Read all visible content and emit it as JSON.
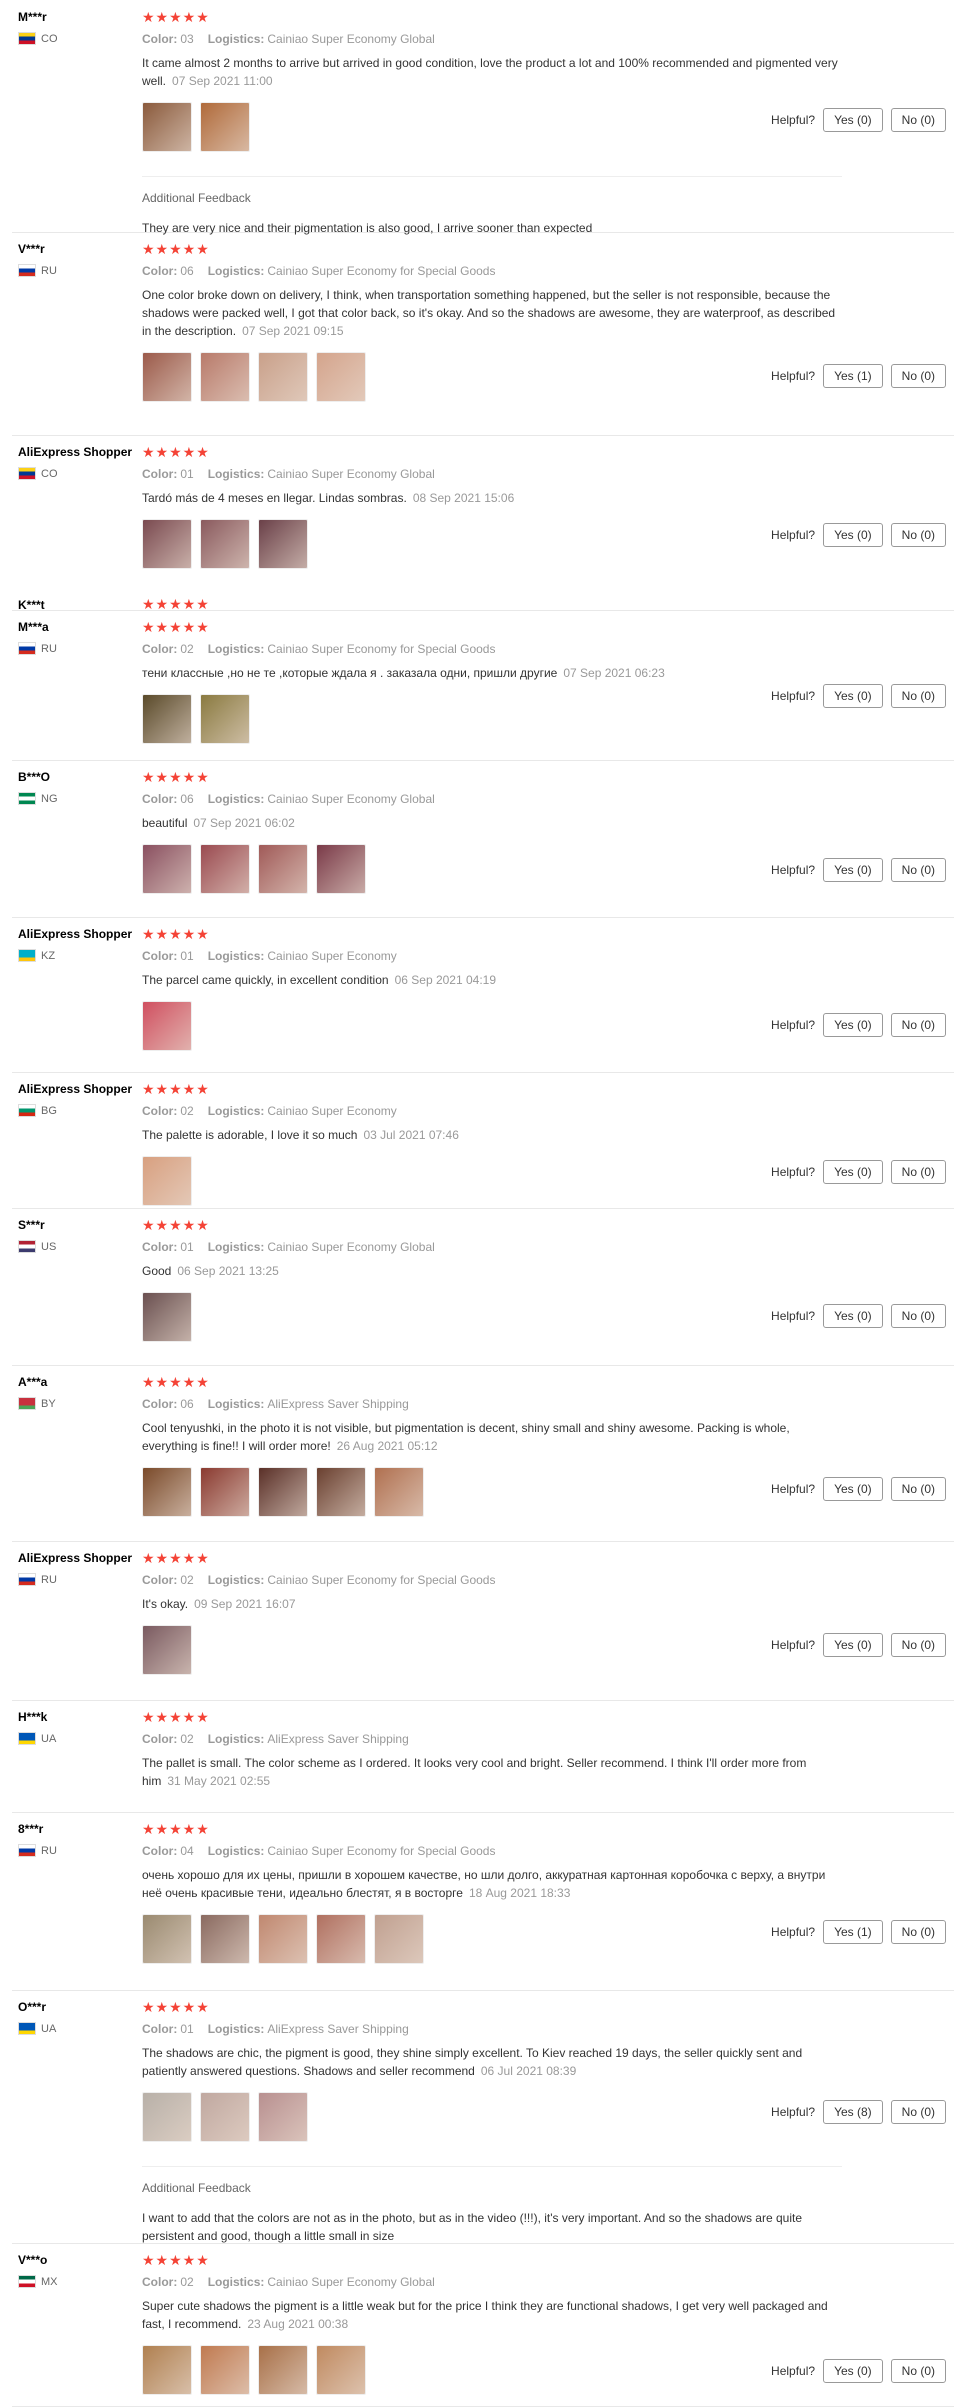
{
  "ui": {
    "color_label": "Color:",
    "logistics_label": "Logistics:",
    "helpful_label": "Helpful?",
    "additional_feedback_label": "Additional Feedback",
    "stars": "★★★★★"
  },
  "reviews": [
    {
      "user": "M***r",
      "country": "CO",
      "flag": [
        "#fcd116",
        "#003893",
        "#ce1126"
      ],
      "color": "03",
      "logistics": "Cainiao Super Economy Global",
      "text": "It came almost 2 months to arrive but arrived in good condition, love the product a lot and 100% recommended and pigmented very well.",
      "date": "07 Sep 2021 11:00",
      "yes": "Yes (0)",
      "no": "No (0)",
      "thumbs": [
        "#8a5a3c",
        "#b06a3a"
      ],
      "additional": "They are very nice and their pigmentation is also good, I arrive sooner than expected"
    },
    {
      "user": "V***r",
      "country": "RU",
      "flag": [
        "#ffffff",
        "#0039a6",
        "#d52b1e"
      ],
      "color": "06",
      "logistics": "Cainiao Super Economy for Special Goods",
      "text": "One color broke down on delivery, I think, when transportation something happened, but the seller is not responsible, because the shadows were packed well, I got that color back, so it's okay. And so the shadows are awesome, they are waterproof, as described in the description.",
      "date": "07 Sep 2021 09:15",
      "yes": "Yes (1)",
      "no": "No (0)",
      "thumbs": [
        "#9b5a4a",
        "#b87a6a",
        "#c9a08a",
        "#d4a48c"
      ]
    },
    {
      "user": "AliExpress Shopper",
      "country": "CO",
      "flag": [
        "#fcd116",
        "#003893",
        "#ce1126"
      ],
      "color": "01",
      "logistics": "Cainiao Super Economy Global",
      "text": "Tardó más de 4 meses en llegar. Lindas sombras.",
      "date": "08 Sep 2021 15:06",
      "yes": "Yes (0)",
      "no": "No (0)",
      "thumbs": [
        "#7a4a50",
        "#8a5a5e",
        "#6a4048"
      ]
    },
    {
      "user": "M***a",
      "country": "RU",
      "flag": [
        "#ffffff",
        "#0039a6",
        "#d52b1e"
      ],
      "color": "02",
      "logistics": "Cainiao Super Economy for Special Goods",
      "text": "тени классные ,но не те ,которые ждала я . заказала одни, пришли другие",
      "date": "07 Sep 2021 06:23",
      "yes": "Yes (0)",
      "no": "No (0)",
      "thumbs": [
        "#5a4a2a",
        "#8a7a40"
      ]
    },
    {
      "user": "B***O",
      "country": "NG",
      "flag": [
        "#008751",
        "#ffffff",
        "#008751"
      ],
      "color": "06",
      "logistics": "Cainiao Super Economy Global",
      "text": "beautiful",
      "date": "07 Sep 2021 06:02",
      "yes": "Yes (0)",
      "no": "No (0)",
      "thumbs": [
        "#8a5060",
        "#9a4a50",
        "#a05a58",
        "#7a3a48"
      ]
    },
    {
      "user": "AliExpress Shopper",
      "country": "KZ",
      "flag": [
        "#00afca",
        "#00afca",
        "#fec50c"
      ],
      "color": "01",
      "logistics": "Cainiao Super Economy",
      "text": "The parcel came quickly, in excellent condition",
      "date": "06 Sep 2021 04:19",
      "yes": "Yes (0)",
      "no": "No (0)",
      "thumbs": [
        "#d05060"
      ]
    },
    {
      "user": "AliExpress Shopper",
      "country": "BG",
      "flag": [
        "#ffffff",
        "#00966e",
        "#d62612"
      ],
      "color": "02",
      "logistics": "Cainiao Super Economy",
      "text": "The palette is adorable, I love it so much",
      "date": "03 Jul 2021 07:46",
      "yes": "Yes (0)",
      "no": "No (0)",
      "thumbs": [
        "#d8a080"
      ]
    },
    {
      "user": "S***r",
      "country": "US",
      "flag": [
        "#b22234",
        "#ffffff",
        "#3c3b6e"
      ],
      "color": "01",
      "logistics": "Cainiao Super Economy Global",
      "text": "Good",
      "date": "06 Sep 2021 13:25",
      "yes": "Yes (0)",
      "no": "No (0)",
      "thumbs": [
        "#6a5050"
      ]
    },
    {
      "user": "A***a",
      "country": "BY",
      "flag": [
        "#c8313e",
        "#c8313e",
        "#4aa657"
      ],
      "color": "06",
      "logistics": "AliExpress Saver Shipping",
      "text": "Cool tenyushki, in the photo it is not visible, but pigmentation is decent, shiny small and shiny awesome. Packing is whole, everything is fine!! I will order more!",
      "date": "26 Aug 2021 05:12",
      "yes": "Yes (0)",
      "no": "No (0)",
      "thumbs": [
        "#7a4a2a",
        "#8a3a30",
        "#5a3028",
        "#6a4030",
        "#b07050"
      ]
    },
    {
      "user": "AliExpress Shopper",
      "country": "RU",
      "flag": [
        "#ffffff",
        "#0039a6",
        "#d52b1e"
      ],
      "color": "02",
      "logistics": "Cainiao Super Economy for Special Goods",
      "text": "It's okay.",
      "date": "09 Sep 2021 16:07",
      "yes": "Yes (0)",
      "no": "No (0)",
      "thumbs": [
        "#7a5a60"
      ]
    },
    {
      "user": "H***k",
      "country": "UA",
      "flag": [
        "#0057b7",
        "#0057b7",
        "#ffd700"
      ],
      "color": "02",
      "logistics": "AliExpress Saver Shipping",
      "text": "The pallet is small. The color scheme as I ordered. It looks very cool and bright. Seller recommend. I think I'll order more from him",
      "date": "31 May 2021 02:55"
    },
    {
      "user": "8***r",
      "country": "RU",
      "flag": [
        "#ffffff",
        "#0039a6",
        "#d52b1e"
      ],
      "color": "04",
      "logistics": "Cainiao Super Economy for Special Goods",
      "text": "очень хорошо для их цены, пришли в хорошем качестве, но шли долго, аккуратная картонная коробочка с верху, а внутри неё очень красивые тени, идеально блестят, я в восторге",
      "date": "18 Aug 2021 18:33",
      "yes": "Yes (1)",
      "no": "No (0)",
      "thumbs": [
        "#9a8a70",
        "#8a6a60",
        "#c08870",
        "#b07060",
        "#c0a090"
      ]
    },
    {
      "user": "O***r",
      "country": "UA",
      "flag": [
        "#0057b7",
        "#0057b7",
        "#ffd700"
      ],
      "color": "01",
      "logistics": "AliExpress Saver Shipping",
      "text": "The shadows are chic, the pigment is good, they shine simply excellent. To Kiev reached 19 days, the seller quickly sent and patiently answered questions. Shadows and seller recommend",
      "date": "06 Jul 2021 08:39",
      "yes": "Yes (8)",
      "no": "No (0)",
      "thumbs": [
        "#b8b0a8",
        "#c0a8a0",
        "#b89090"
      ],
      "additional": "I want to add that the colors are not as in the photo, but as in the video (!!!), it's very important. And so the shadows are quite persistent and good, though a little small in size"
    },
    {
      "user": "V***o",
      "country": "MX",
      "flag": [
        "#006847",
        "#ffffff",
        "#ce1126"
      ],
      "color": "02",
      "logistics": "Cainiao Super Economy Global",
      "text": "Super cute shadows the pigment is a little weak but for the price I think they are functional shadows, I get very well packaged and fast, I recommend.",
      "date": "23 Aug 2021 00:38",
      "yes": "Yes (0)",
      "no": "No (0)",
      "thumbs": [
        "#b08050",
        "#c07a50",
        "#a87048",
        "#c08a60"
      ]
    }
  ],
  "overlay": {
    "user": "K***t"
  }
}
